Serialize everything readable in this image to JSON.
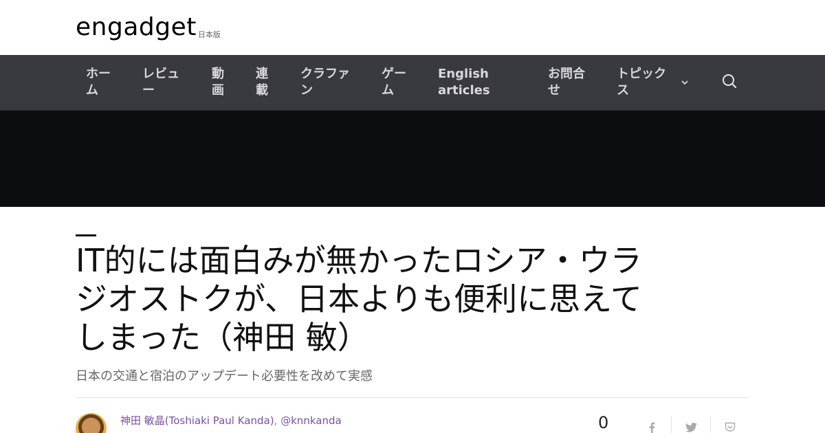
{
  "brand": {
    "name": "engadget",
    "edition": "日本版"
  },
  "nav": {
    "items": [
      {
        "label": "ホーム"
      },
      {
        "label": "レビュー"
      },
      {
        "label": "動画"
      },
      {
        "label": "連載"
      },
      {
        "label": "クラファン"
      },
      {
        "label": "ゲーム"
      },
      {
        "label": "English articles"
      },
      {
        "label": "お問合せ"
      },
      {
        "label": "トピックス"
      }
    ],
    "search_icon": "search-icon",
    "dropdown_icon": "chevron-down-icon"
  },
  "article": {
    "title": "IT的には面白みが無かったロシア・ウラジオストクが、日本よりも便利に思えてしまった（神田 敏）",
    "subtitle": "日本の交通と宿泊のアップデート必要性を改めて実感",
    "author": {
      "name": "神田 敏晶(Toshiaki Paul Kanda)",
      "separator": ",",
      "handle": "@knnkanda"
    },
    "comments": "0",
    "share_icons": [
      "facebook-icon",
      "twitter-icon",
      "pocket-icon"
    ]
  },
  "colors": {
    "nav_bg": "#393a40",
    "banner_bg": "#0c0d10",
    "author_link": "#7b4fa3"
  }
}
